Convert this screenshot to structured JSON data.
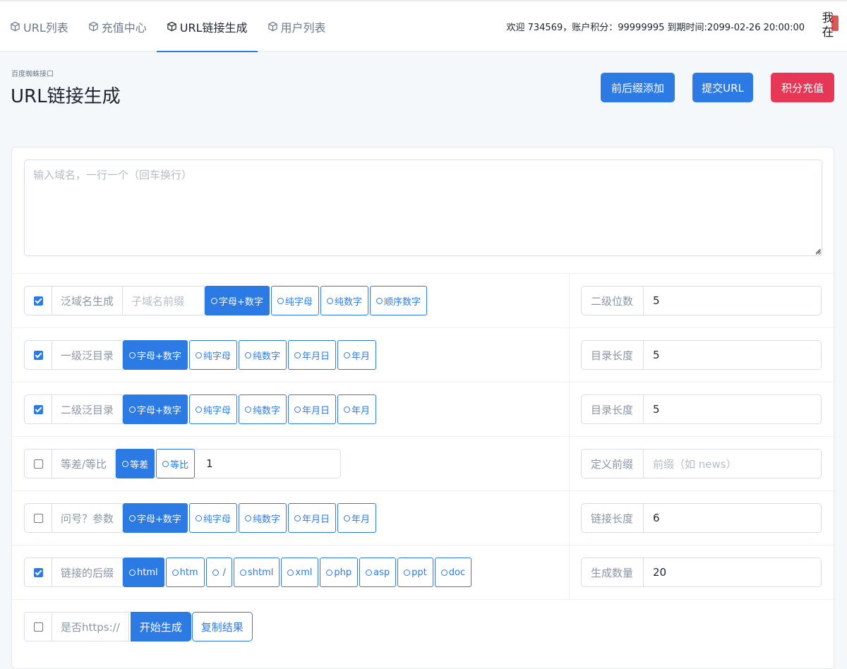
{
  "nav": {
    "items": [
      {
        "label": "URL列表",
        "icon": "cube-icon"
      },
      {
        "label": "充值中心",
        "icon": "cube-icon"
      },
      {
        "label": "URL链接生成",
        "icon": "cube-icon",
        "active": true
      },
      {
        "label": "用户列表",
        "icon": "cube-icon"
      }
    ],
    "welcome": "欢迎 734569，账户积分：99999995 到期时间:2099-02-26 20:00:00",
    "avatar_text": "我在"
  },
  "header": {
    "pretitle": "百度蜘蛛接口",
    "title": "URL链接生成",
    "btn_affix": "前后缀添加",
    "btn_submit": "提交URL",
    "btn_recharge": "积分充值"
  },
  "domains": {
    "placeholder": "输入域名，一行一个（回车换行）"
  },
  "rows": {
    "wildcard": {
      "label": "泛域名生成",
      "sub_placeholder": "子域名前缀",
      "options": [
        "字母+数字",
        "纯字母",
        "纯数字",
        "顺序数字"
      ],
      "right_label": "二级位数",
      "right_value": "5"
    },
    "dir1": {
      "label": "一级泛目录",
      "options": [
        "字母+数字",
        "纯字母",
        "纯数字",
        "年月日",
        "年月"
      ],
      "right_label": "目录长度",
      "right_value": "5"
    },
    "dir2": {
      "label": "二级泛目录",
      "options": [
        "字母+数字",
        "纯字母",
        "纯数字",
        "年月日",
        "年月"
      ],
      "right_label": "目录长度",
      "right_value": "5"
    },
    "progression": {
      "label": "等差/等比",
      "options": [
        "等差",
        "等比"
      ],
      "value": "1",
      "right_label": "定义前缀",
      "right_placeholder": "前缀（如 news）"
    },
    "query": {
      "label": "问号？参数",
      "options": [
        "字母+数字",
        "纯字母",
        "纯数字",
        "年月日",
        "年月"
      ],
      "right_label": "链接长度",
      "right_value": "6"
    },
    "suffix": {
      "label": "链接的后缀",
      "options": [
        "html",
        "htm",
        "/",
        "shtml",
        "xml",
        "php",
        "asp",
        "ppt",
        "doc"
      ],
      "right_label": "生成数量",
      "right_value": "20"
    },
    "https": {
      "label": "是否https://",
      "start": "开始生成",
      "copy": "复制结果"
    }
  },
  "colors": {
    "primary": "#2c7be5",
    "danger": "#e63757"
  }
}
